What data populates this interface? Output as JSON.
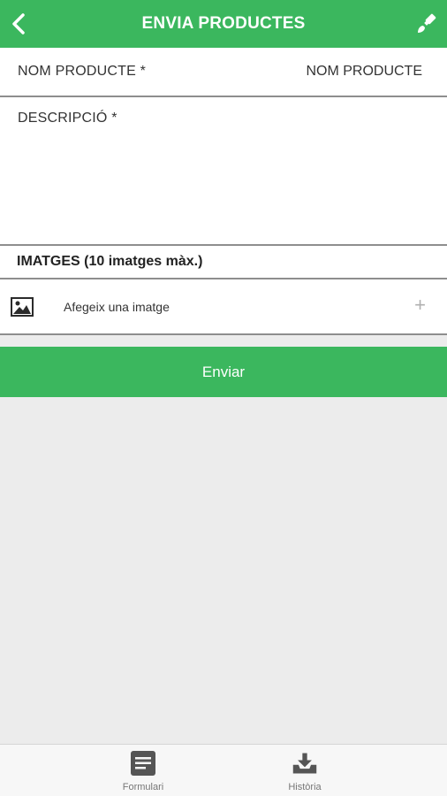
{
  "header": {
    "title": "ENVIA PRODUCTES",
    "back_icon": "chevron-left-icon",
    "brush_icon": "paint-brush-icon",
    "color": "#3bb75e"
  },
  "form": {
    "name_label": "NOM PRODUCTE *",
    "name_placeholder": "NOM PRODUCTE",
    "description_label": "DESCRIPCIÓ *",
    "images_title": "IMATGES (10 imatges màx.)",
    "add_image_label": "Afegeix una imatge",
    "add_image_icon": "image-icon",
    "plus": "+"
  },
  "submit_label": "Enviar",
  "tabbar": {
    "tabs": [
      {
        "label": "Formulari",
        "icon": "form-icon"
      },
      {
        "label": "Història",
        "icon": "download-tray-icon"
      }
    ]
  }
}
